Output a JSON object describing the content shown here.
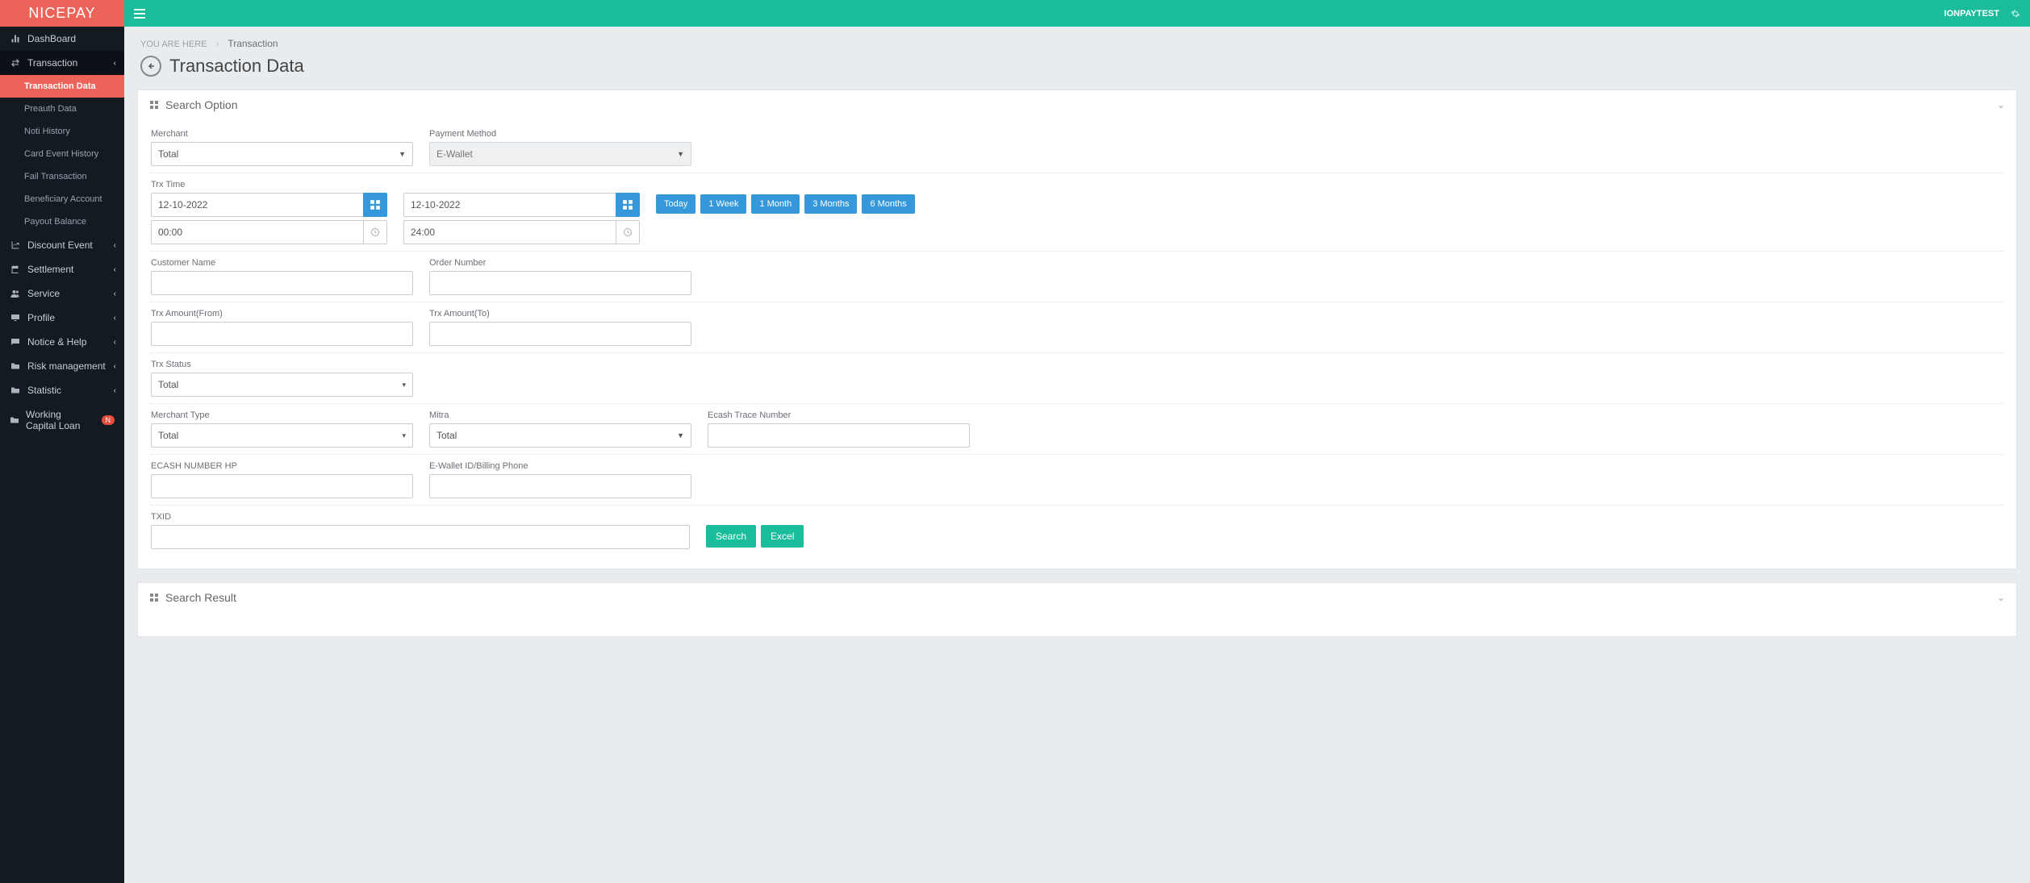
{
  "brand": "NICEPAY",
  "user_name": "IONPAYTEST",
  "sidebar": {
    "items": [
      {
        "label": "DashBoard",
        "icon": "dashboard"
      },
      {
        "label": "Transaction",
        "icon": "exchange",
        "open": true,
        "children": [
          {
            "label": "Transaction Data",
            "active": true
          },
          {
            "label": "Preauth Data"
          },
          {
            "label": "Noti History"
          },
          {
            "label": "Card Event History"
          },
          {
            "label": "Fail Transaction"
          },
          {
            "label": "Beneficiary Account"
          },
          {
            "label": "Payout Balance"
          }
        ]
      },
      {
        "label": "Discount Event",
        "icon": "chart"
      },
      {
        "label": "Settlement",
        "icon": "calendar"
      },
      {
        "label": "Service",
        "icon": "users"
      },
      {
        "label": "Profile",
        "icon": "monitor"
      },
      {
        "label": "Notice & Help",
        "icon": "comment"
      },
      {
        "label": "Risk management",
        "icon": "folder"
      },
      {
        "label": "Statistic",
        "icon": "folder"
      },
      {
        "label": "Working Capital Loan",
        "icon": "folder",
        "badge": "N"
      }
    ]
  },
  "breadcrumb": {
    "here": "YOU ARE HERE",
    "current": "Transaction"
  },
  "page_title": "Transaction Data",
  "panel": {
    "search_option": "Search Option",
    "search_result": "Search Result"
  },
  "labels": {
    "merchant": "Merchant",
    "payment_method": "Payment Method",
    "trx_time": "Trx Time",
    "customer_name": "Customer Name",
    "order_number": "Order Number",
    "trx_amount_from": "Trx Amount(From)",
    "trx_amount_to": "Trx Amount(To)",
    "trx_status": "Trx Status",
    "merchant_type": "Merchant Type",
    "mitra": "Mitra",
    "ecash_trace": "Ecash Trace Number",
    "ecash_hp": "ECASH NUMBER HP",
    "ewallet_id": "E-Wallet ID/Billing Phone",
    "txid": "TXID"
  },
  "values": {
    "merchant": "Total",
    "payment_method": "E-Wallet",
    "date_from": "12-10-2022",
    "date_to": "12-10-2022",
    "time_from": "00:00",
    "time_to": "24:00",
    "trx_status": "Total",
    "merchant_type": "Total",
    "mitra": "Total"
  },
  "range_buttons": [
    "Today",
    "1 Week",
    "1 Month",
    "3 Months",
    "6 Months"
  ],
  "actions": {
    "search": "Search",
    "excel": "Excel"
  }
}
